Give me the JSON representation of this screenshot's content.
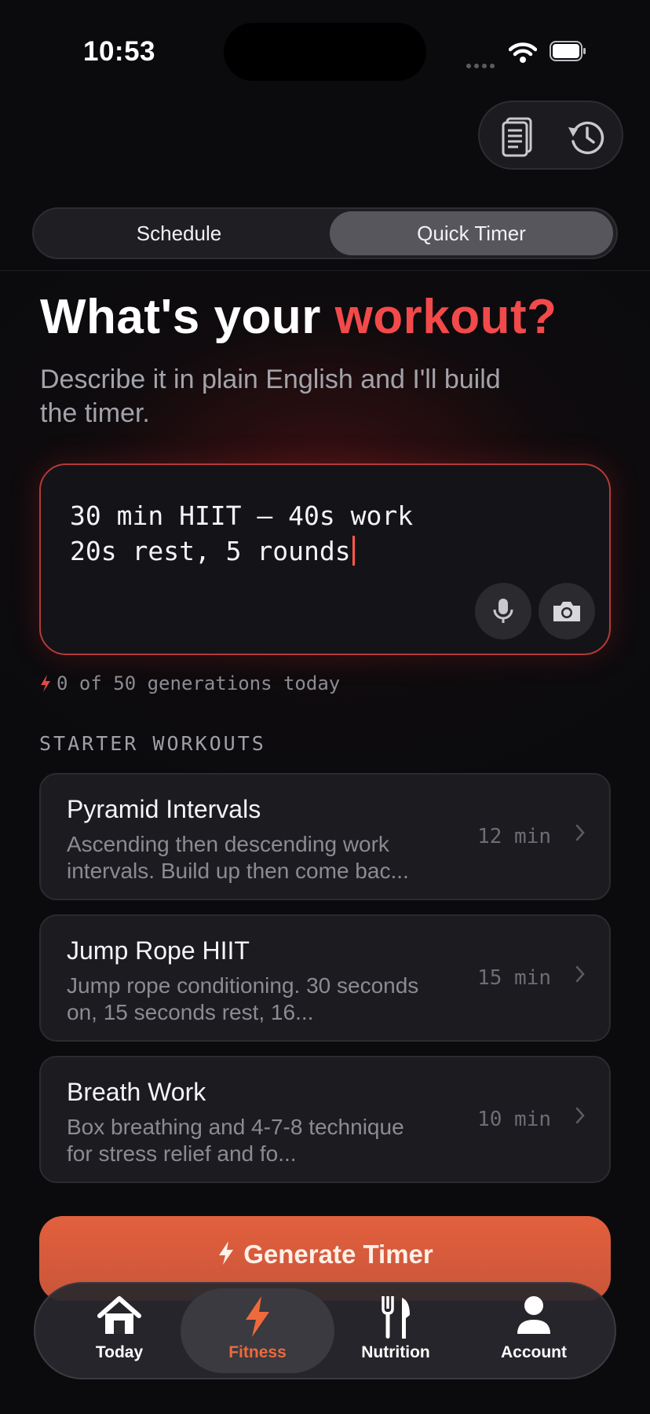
{
  "status_bar": {
    "time": "10:53"
  },
  "header": {
    "notes_icon": "notes-icon",
    "history_icon": "history-icon"
  },
  "segment": {
    "left": "Schedule",
    "right": "Quick Timer",
    "selected": "Quick Timer"
  },
  "hero": {
    "title_prefix": "What's your ",
    "title_accent": "workout?",
    "subtitle": "Describe it in plain English and I'll build the timer."
  },
  "prompt": {
    "line1": "30 min HIIT — 40s work",
    "line2": "20s rest, 5 rounds",
    "mic_icon": "microphone-icon",
    "camera_icon": "camera-icon"
  },
  "generations": "0 of 50 generations today",
  "starter": {
    "heading": "STARTER WORKOUTS",
    "items": [
      {
        "title": "Pyramid Intervals",
        "desc": "Ascending then descending work intervals. Build up then come bac...",
        "duration": "12 min"
      },
      {
        "title": "Jump Rope HIIT",
        "desc": "Jump rope conditioning. 30 seconds on, 15 seconds rest, 16...",
        "duration": "15 min"
      },
      {
        "title": "Breath Work",
        "desc": "Box breathing and 4-7-8 technique for stress relief and fo...",
        "duration": "10 min"
      }
    ]
  },
  "generate_button": "Generate Timer",
  "tabs": [
    {
      "label": "Today",
      "icon": "home-icon"
    },
    {
      "label": "Fitness",
      "icon": "bolt-icon",
      "active": true
    },
    {
      "label": "Nutrition",
      "icon": "fork-knife-icon"
    },
    {
      "label": "Account",
      "icon": "person-icon"
    }
  ],
  "colors": {
    "accent": "#f24a4a",
    "generate": "#e2603d",
    "active_tab": "#ee6a3c"
  }
}
